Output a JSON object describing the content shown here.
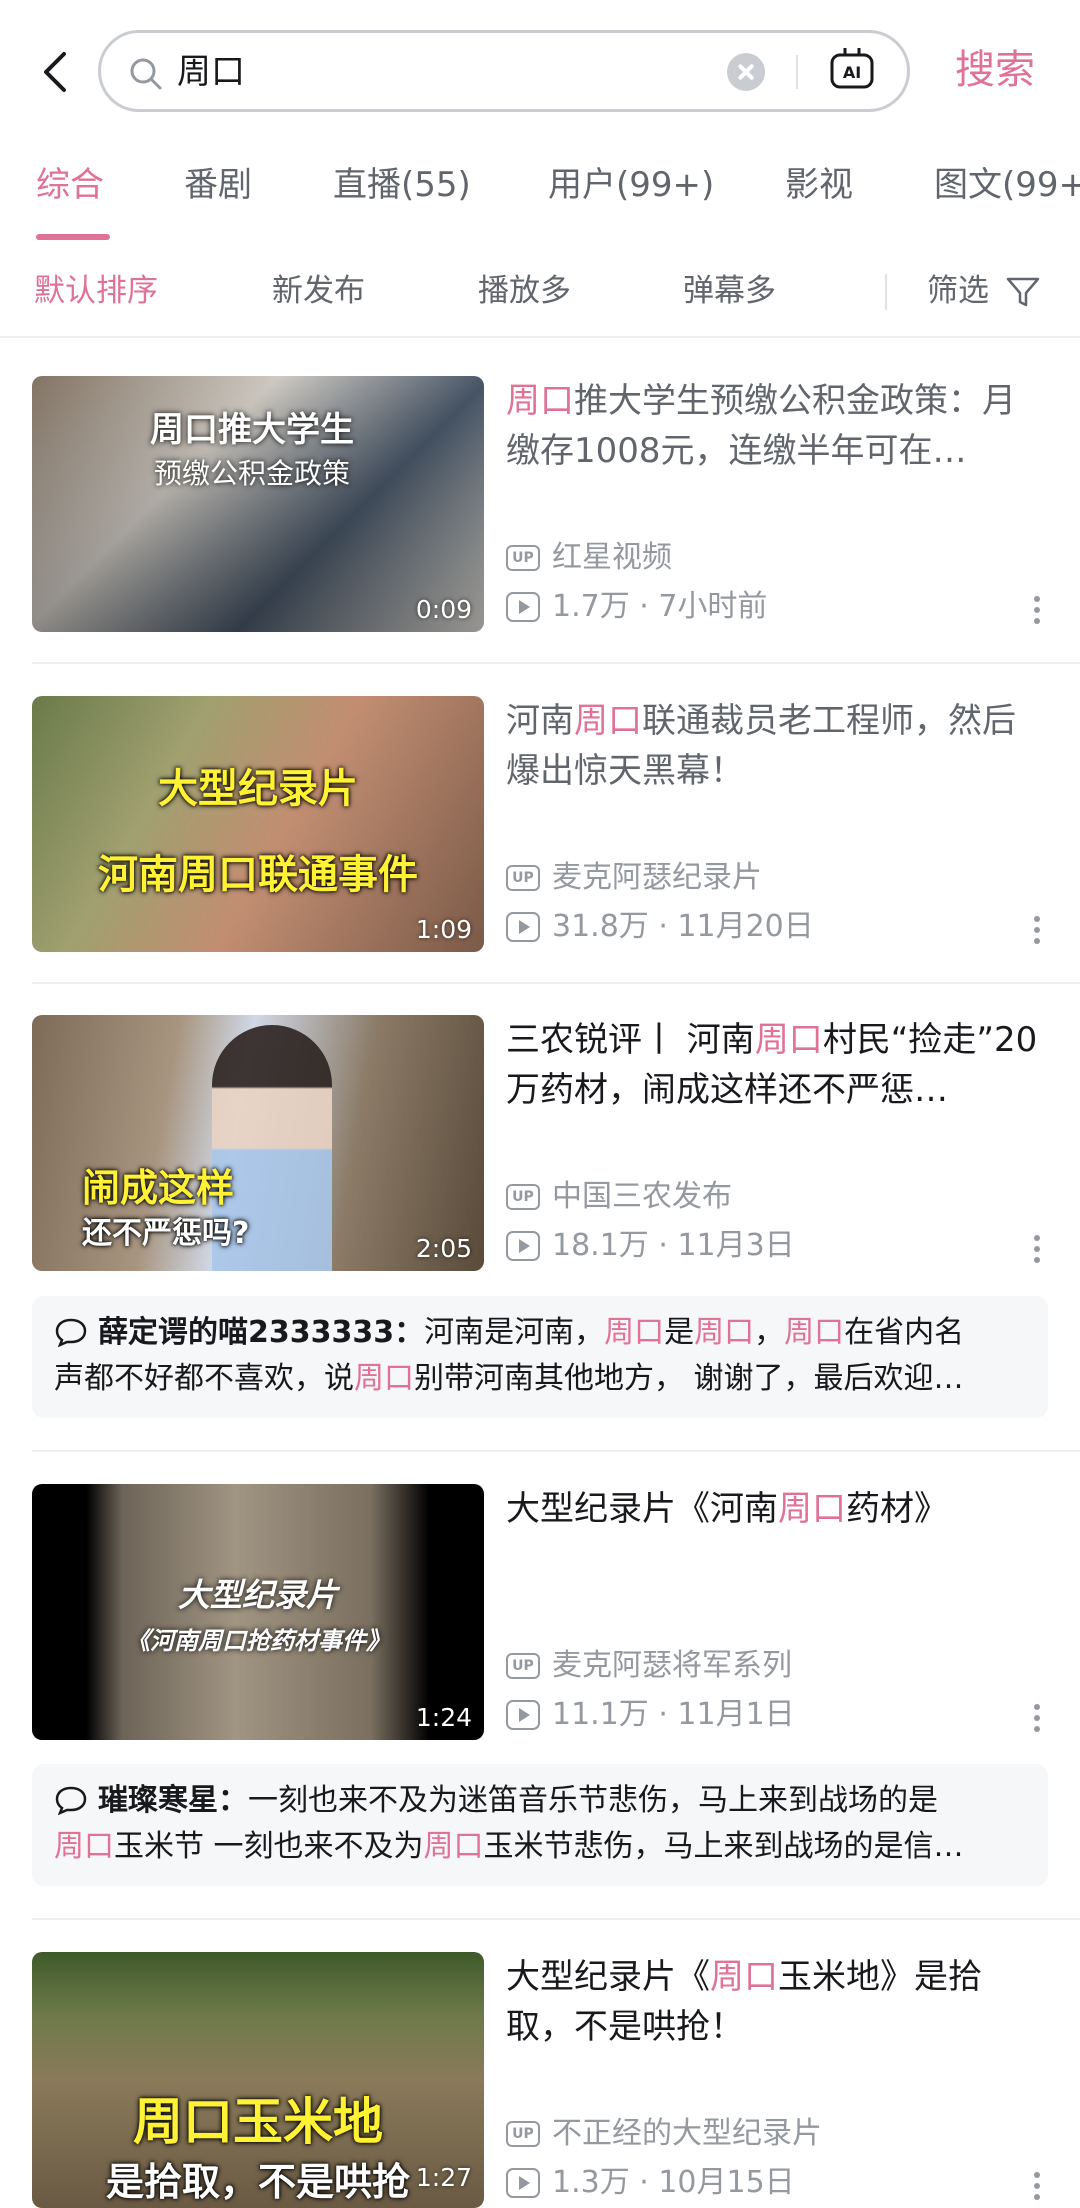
{
  "search": {
    "query": "周口",
    "button": "搜索"
  },
  "tabs": [
    "综合",
    "番剧",
    "直播(55)",
    "用户(99+)",
    "影视",
    "图文(99+"
  ],
  "sort": {
    "options": [
      "默认排序",
      "新发布",
      "播放多",
      "弹幕多"
    ],
    "filter": "筛选"
  },
  "items": [
    {
      "title": [
        "",
        "周口",
        "推大学生预缴公积金政策：月缴存1008元，连缴半年可在…"
      ],
      "author": "红星视频",
      "views": "1.7万",
      "date": "7小时前",
      "duration": "0:09",
      "thumb_text": [
        "周口推大学生",
        "预缴公积金政策"
      ]
    },
    {
      "title": [
        "河南",
        "周口",
        "联通裁员老工程师，然后爆出惊天黑幕！"
      ],
      "author": "麦克阿瑟纪录片",
      "views": "31.8万",
      "date": "11月20日",
      "duration": "1:09",
      "thumb_text": [
        "大型纪录片",
        "河南周口联通事件"
      ]
    },
    {
      "title": [
        "三农锐评丨 河南",
        "周口",
        "村民“捡走”20万药材，闹成这样还不严惩…"
      ],
      "author": "中国三农发布",
      "views": "18.1万",
      "date": "11月3日",
      "duration": "2:05",
      "thumb_text": [
        "闹成这样",
        "还不严惩吗?"
      ],
      "comment": {
        "user": "薛定谔的喵2333333：",
        "line1": [
          "河南是河南，",
          "周口",
          "是",
          "周口",
          "，",
          "周口",
          "在省内名"
        ],
        "line2": [
          "声都不好都不喜欢，说",
          "周口",
          "别带河南其他地方， 谢谢了，最后欢迎…"
        ]
      }
    },
    {
      "title": [
        "大型纪录片《河南",
        "周口",
        "药材》"
      ],
      "author": "麦克阿瑟将军系列",
      "views": "11.1万",
      "date": "11月1日",
      "duration": "1:24",
      "thumb_text": [
        "大型纪录片",
        "《河南周口抢药材事件》"
      ],
      "comment": {
        "user": "璀璨寒星：",
        "line1": [
          "一刻也来不及为迷笛音乐节悲伤，马上来到战场的是"
        ],
        "line2": [
          "周口",
          "玉米节 一刻也来不及为",
          "周口",
          "玉米节悲伤，马上来到战场的是信…"
        ]
      }
    },
    {
      "title": [
        "大型纪录片《",
        "周口",
        "玉米地》是拾取，不是哄抢！"
      ],
      "author": "不正经的大型纪录片",
      "views": "1.3万",
      "date": "10月15日",
      "duration": "1:27",
      "thumb_text": [
        "周口玉米地",
        "是拾取，不是哄抢"
      ]
    }
  ]
}
